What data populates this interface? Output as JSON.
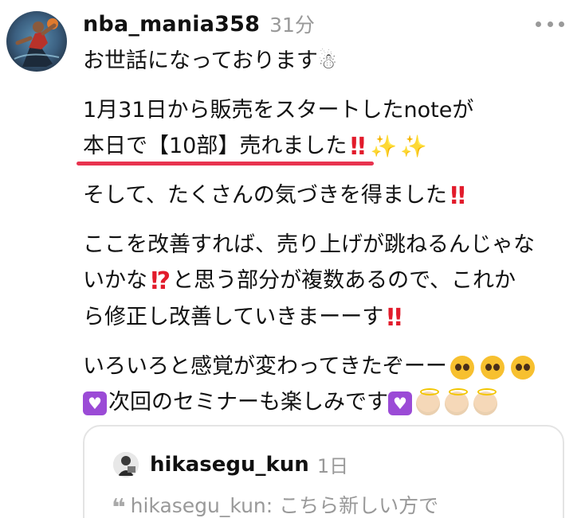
{
  "post": {
    "username": "nba_mania358",
    "timestamp": "31分",
    "lines": {
      "greeting": "お世話になっております",
      "p2_line1": "1月31日から販売をスタートしたnoteが",
      "p2_line2": "本日で【10部】売れました",
      "p3_line1": "そして、たくさんの気づきを得ました",
      "p4_line1": "ここを改善すれば、売り上げが跳ねるんじゃな",
      "p4_line2a": "いかな",
      "p4_line2b": "と思う部分が複数あるので、これか",
      "p4_line3": "ら修正し改善していきまーーす",
      "p5_line1": "いろいろと感覚が変わってきたぞーー",
      "p5_line2": "次回のセミナーも楽しみです"
    }
  },
  "quote": {
    "username": "hikasegu_kun",
    "timestamp": "1日",
    "text": "hikasegu_kun: こちら新しい方で"
  },
  "icons": {
    "snowman": "snowman-icon",
    "double_exclamation": "double-exclamation-icon",
    "interrobang": "exclamation-question-icon",
    "sparkles": "sparkles-icon",
    "pleading_face": "pleading-face-icon",
    "purple_heart": "purple-heart-icon",
    "baby_angel": "baby-angel-icon",
    "quote_mark": "quote-mark-icon",
    "more": "more-dots-icon"
  },
  "colors": {
    "underline": "#e8334f",
    "timestamp": "#999999",
    "text": "#111111"
  }
}
